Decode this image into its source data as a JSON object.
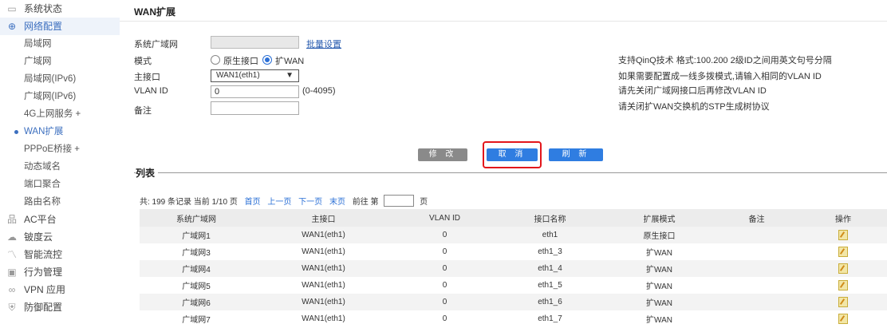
{
  "sidebar": {
    "top_items": [
      {
        "label": "系统状态",
        "icon": "monitor-icon"
      },
      {
        "label": "网络配置",
        "icon": "globe-icon"
      }
    ],
    "sub_items": [
      {
        "label": "局域网"
      },
      {
        "label": "广域网"
      },
      {
        "label": "局域网(IPv6)"
      },
      {
        "label": "广域网(IPv6)"
      },
      {
        "label": "4G上网服务 +"
      },
      {
        "label": "WAN扩展"
      },
      {
        "label": "PPPoE桥接 +"
      },
      {
        "label": "动态域名"
      },
      {
        "label": "端口聚合"
      },
      {
        "label": "路由名称"
      }
    ],
    "bottom_items": [
      {
        "label": "AC平台",
        "icon": "network-icon"
      },
      {
        "label": "铍度云",
        "icon": "cloud-icon"
      },
      {
        "label": "智能流控",
        "icon": "flow-icon"
      },
      {
        "label": "行为管理",
        "icon": "behavior-icon"
      },
      {
        "label": "VPN 应用",
        "icon": "vpn-icon"
      },
      {
        "label": "防御配置",
        "icon": "shield-icon"
      }
    ]
  },
  "header": {
    "title": "WAN扩展"
  },
  "form": {
    "wan_label": "系统广域网",
    "batch_link": "批量设置",
    "mode_label": "模式",
    "mode_opt1": "原生接口",
    "mode_opt2": "扩WAN",
    "iface_label": "主接口",
    "iface_value": "WAN1(eth1)",
    "vlan_label": "VLAN ID",
    "vlan_value": "0",
    "vlan_range": "(0-4095)",
    "remark_label": "备注"
  },
  "notes": [
    "支持QinQ技术 格式:100.200 2级ID之间用英文句号分隔",
    "如果需要配置成一线多拨模式,请输入相同的VLAN ID",
    "请先关闭广域网接口后再修改VLAN ID",
    "请关闭扩WAN交换机的STP生成树协议"
  ],
  "buttons": {
    "modify": "修 改",
    "cancel": "取 消",
    "refresh": "刷 新"
  },
  "list": {
    "title": "列表",
    "pager_text": "共: 199 条记录 当前 1/10 页",
    "first": "首页",
    "prev": "上一页",
    "next": "下一页",
    "last": "末页",
    "goto_label": "前往 第",
    "page_unit": "页",
    "columns": [
      "系统广域网",
      "主接口",
      "VLAN ID",
      "接口名称",
      "扩展模式",
      "备注",
      "操作"
    ],
    "rows": [
      [
        "广域网1",
        "WAN1(eth1)",
        "0",
        "eth1",
        "原生接口",
        ""
      ],
      [
        "广域网3",
        "WAN1(eth1)",
        "0",
        "eth1_3",
        "扩WAN",
        ""
      ],
      [
        "广域网4",
        "WAN1(eth1)",
        "0",
        "eth1_4",
        "扩WAN",
        ""
      ],
      [
        "广域网5",
        "WAN1(eth1)",
        "0",
        "eth1_5",
        "扩WAN",
        ""
      ],
      [
        "广域网6",
        "WAN1(eth1)",
        "0",
        "eth1_6",
        "扩WAN",
        ""
      ],
      [
        "广域网7",
        "WAN1(eth1)",
        "0",
        "eth1_7",
        "扩WAN",
        ""
      ]
    ]
  }
}
